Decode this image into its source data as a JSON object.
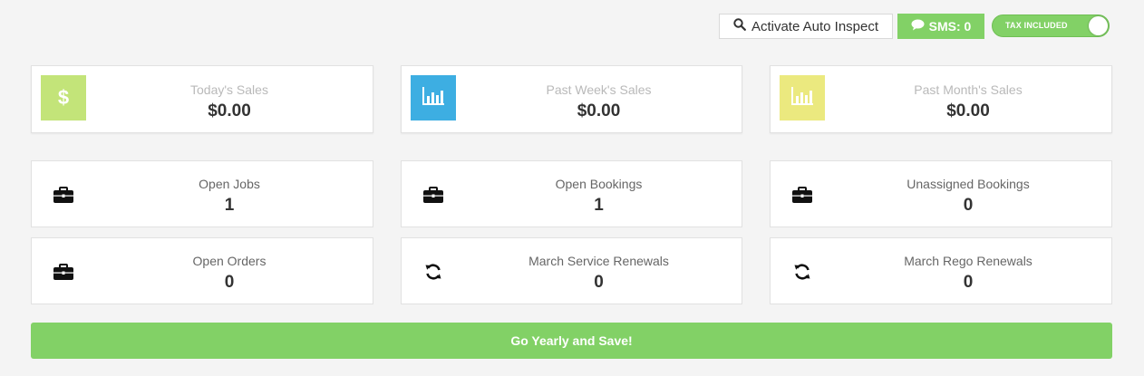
{
  "toolbar": {
    "auto_inspect_label": "Activate Auto Inspect",
    "sms_label": "SMS: 0",
    "tax_toggle_label": "TAX INCLUDED",
    "tax_included_on": true
  },
  "sales": [
    {
      "label": "Today's Sales",
      "value": "$0.00",
      "icon": "dollar-icon",
      "color": "#c3e479"
    },
    {
      "label": "Past Week's Sales",
      "value": "$0.00",
      "icon": "bar-chart-icon",
      "color": "#3daee2"
    },
    {
      "label": "Past Month's Sales",
      "value": "$0.00",
      "icon": "bar-chart-icon",
      "color": "#ebe97f"
    }
  ],
  "stats": [
    {
      "label": "Open Jobs",
      "value": "1",
      "icon": "briefcase-icon"
    },
    {
      "label": "Open Bookings",
      "value": "1",
      "icon": "briefcase-icon"
    },
    {
      "label": "Unassigned Bookings",
      "value": "0",
      "icon": "briefcase-icon"
    },
    {
      "label": "Open Orders",
      "value": "0",
      "icon": "briefcase-icon"
    },
    {
      "label": "March Service Renewals",
      "value": "0",
      "icon": "refresh-icon"
    },
    {
      "label": "March Rego Renewals",
      "value": "0",
      "icon": "refresh-icon"
    }
  ],
  "promo": {
    "label": "Go Yearly and Save!"
  },
  "colors": {
    "accent_green": "#82d166",
    "background": "#f4f4f4"
  }
}
